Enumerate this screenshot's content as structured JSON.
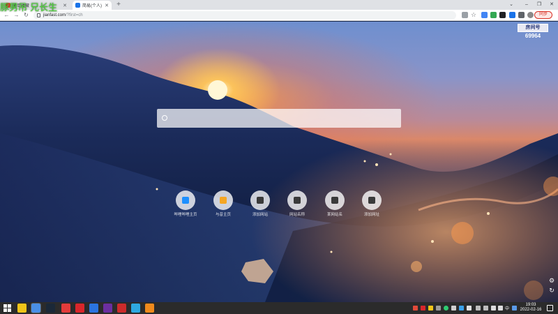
{
  "overlay": {
    "text": "豚男吊 兄长生"
  },
  "tabs": [
    {
      "title": "简单收藏",
      "active": false,
      "favicon_color": "#e04a3a"
    },
    {
      "title": "简易(个人)",
      "active": true,
      "favicon_color": "#1a73e8"
    }
  ],
  "toolbar": {
    "url_host": "jianfast.com",
    "url_path": "/?first=ch",
    "profile_label": "同步"
  },
  "room": {
    "label": "房间号",
    "number": "69964"
  },
  "search": {
    "placeholder": ""
  },
  "shortcuts": [
    {
      "label": "哔哩哔哩主页",
      "color": "#1e90ff",
      "icon": "bilibili-icon"
    },
    {
      "label": "与昔主页",
      "color": "#f5a623",
      "icon": "orange-circle-icon"
    },
    {
      "label": "添加网站",
      "color": "#3a3a3a",
      "icon": "link-icon"
    },
    {
      "label": "网站名称",
      "color": "#3a3a3a",
      "icon": "link-icon"
    },
    {
      "label": "某网站名",
      "color": "#3a3a3a",
      "icon": "link-icon"
    },
    {
      "label": "添加网址",
      "color": "#3a3a3a",
      "icon": "link-icon"
    }
  ],
  "taskbar": {
    "apps": [
      {
        "name": "file-explorer",
        "color": "#f0c419"
      },
      {
        "name": "chrome",
        "color": "#4a8fe7"
      },
      {
        "name": "steam",
        "color": "#1b2838"
      },
      {
        "name": "red-app",
        "color": "#e23b3b"
      },
      {
        "name": "netease-music",
        "color": "#d9262b"
      },
      {
        "name": "blue-app",
        "color": "#2b74e0"
      },
      {
        "name": "purple-app",
        "color": "#6b2fa0"
      },
      {
        "name": "obs",
        "color": "#cc2b2b"
      },
      {
        "name": "lightblue-app",
        "color": "#2ea8e0"
      },
      {
        "name": "orange-app",
        "color": "#f08a1c"
      }
    ],
    "time": "19:03",
    "date": "2022-02-16",
    "ime": "中"
  }
}
